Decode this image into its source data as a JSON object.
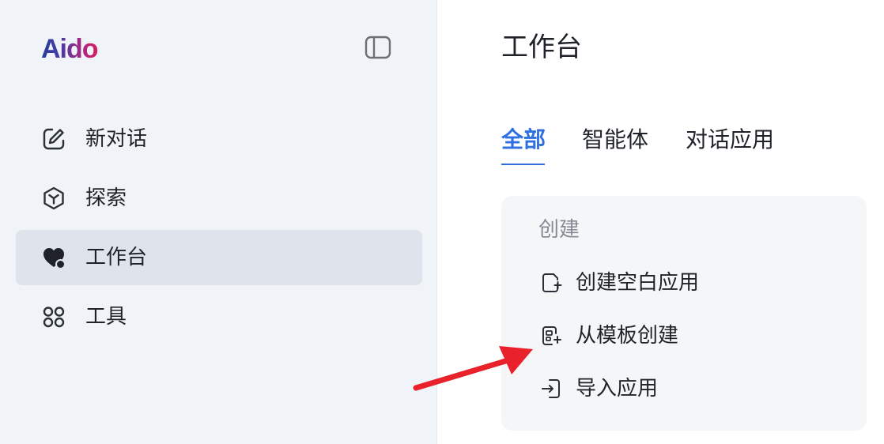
{
  "sidebar": {
    "logo": "Aido",
    "items": [
      {
        "label": "新对话",
        "icon": "edit-icon"
      },
      {
        "label": "探索",
        "icon": "explore-hex-icon"
      },
      {
        "label": "工作台",
        "icon": "workbench-heart-icon",
        "active": true
      },
      {
        "label": "工具",
        "icon": "tools-grid-icon"
      }
    ]
  },
  "main": {
    "title": "工作台",
    "tabs": [
      {
        "label": "全部",
        "active": true
      },
      {
        "label": "智能体"
      },
      {
        "label": "对话应用"
      }
    ],
    "create": {
      "heading": "创建",
      "items": [
        {
          "label": "创建空白应用",
          "icon": "blank-file-plus-icon"
        },
        {
          "label": "从模板创建",
          "icon": "template-plus-icon"
        },
        {
          "label": "导入应用",
          "icon": "import-icon"
        }
      ]
    }
  },
  "colors": {
    "accent": "#2f6fe0",
    "sidebar_bg": "#f0f3f8",
    "active_item_bg": "#dfe4ec",
    "panel_bg": "#f5f6f7",
    "annotation_arrow": "#e8212b"
  }
}
